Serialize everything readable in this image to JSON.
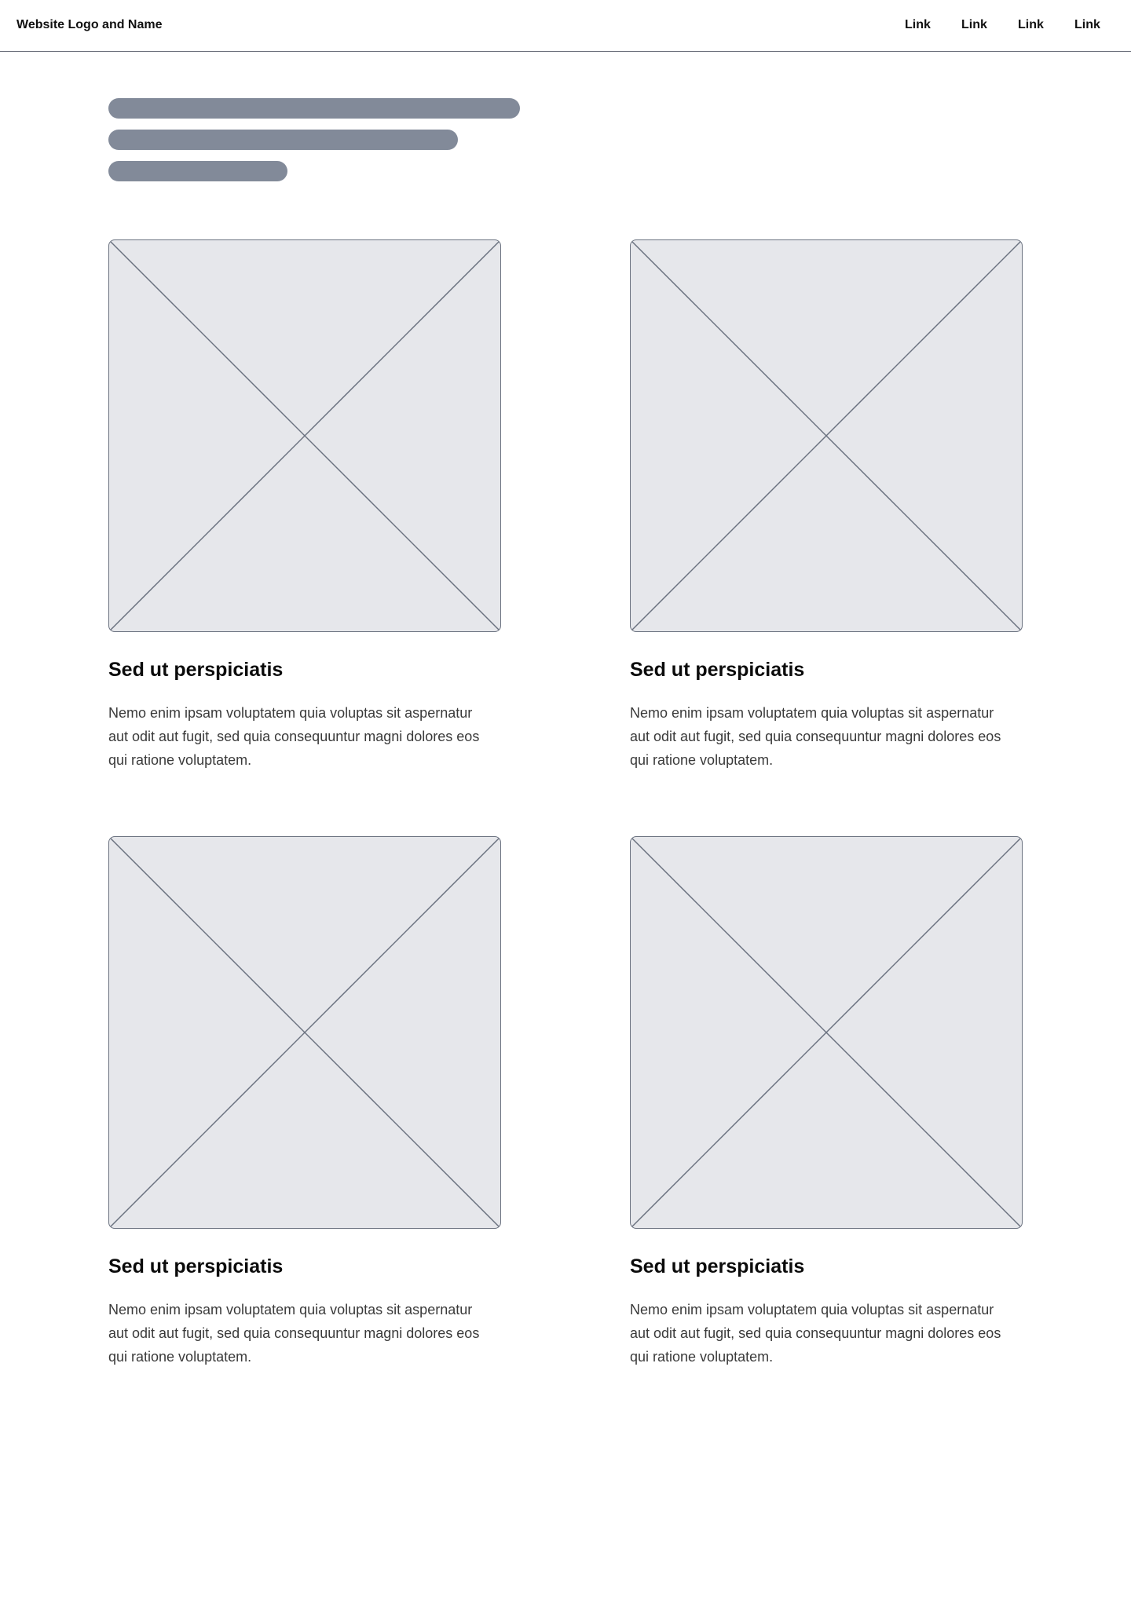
{
  "header": {
    "logo_text": "Website Logo and Name",
    "nav": [
      {
        "label": "Link"
      },
      {
        "label": "Link"
      },
      {
        "label": "Link"
      },
      {
        "label": "Link"
      }
    ]
  },
  "colors": {
    "placeholder_bar": "#828a99",
    "image_fill": "#e6e7eb",
    "image_stroke": "#6b7280"
  },
  "cards": [
    {
      "image_icon": "image-placeholder-icon",
      "title": "Sed ut perspiciatis",
      "text": "Nemo enim ipsam voluptatem quia voluptas sit aspernatur aut odit aut fugit, sed quia consequuntur magni dolores eos qui ratione voluptatem."
    },
    {
      "image_icon": "image-placeholder-icon",
      "title": "Sed ut perspiciatis",
      "text": "Nemo enim ipsam voluptatem quia voluptas sit aspernatur aut odit aut fugit, sed quia consequuntur magni dolores eos qui ratione voluptatem."
    },
    {
      "image_icon": "image-placeholder-icon",
      "title": "Sed ut perspiciatis",
      "text": "Nemo enim ipsam voluptatem quia voluptas sit aspernatur aut odit aut fugit, sed quia consequuntur magni dolores eos qui ratione voluptatem."
    },
    {
      "image_icon": "image-placeholder-icon",
      "title": "Sed ut perspiciatis",
      "text": "Nemo enim ipsam voluptatem quia voluptas sit aspernatur aut odit aut fugit, sed quia consequuntur magni dolores eos qui ratione voluptatem."
    }
  ]
}
